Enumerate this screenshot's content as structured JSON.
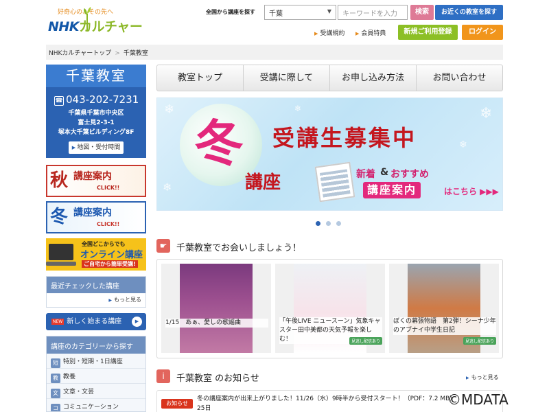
{
  "header": {
    "logo_tagline": "好奇心の、その先へ",
    "logo_nhk": "NHK",
    "logo_culture": "カルチャー",
    "search_label": "全国から講座を探す",
    "prefecture_selected": "千葉",
    "keyword_placeholder": "キーワードを入力",
    "search_button": "検索",
    "nearby_button": "お近くの教室を探す",
    "terms_link": "受講規約",
    "member_link": "会員特典",
    "register_button": "新規ご利用登録",
    "login_button": "ログイン"
  },
  "breadcrumb": [
    "NHKカルチャートップ",
    "千葉教室"
  ],
  "school": {
    "name": "千葉教室",
    "tel": "043-202-7231",
    "address": [
      "千葉県千葉市中央区",
      "富士見2-3-1",
      "塚本大千葉ビルディング8F"
    ],
    "map_button": "地図・受付時間"
  },
  "banners": {
    "autumn": {
      "kanji": "秋",
      "label": "講座案内",
      "click": "CLICK!!"
    },
    "winter": {
      "kanji": "冬",
      "label": "講座案内",
      "click": "CLICK!!"
    },
    "online": {
      "line1": "全国どこからでも",
      "line2": "オンライン講座",
      "line3": "ご自宅から簡単受講!"
    }
  },
  "sidebar": {
    "recent_title": "最近チェックした講座",
    "recent_more": "もっと見る",
    "new_badge": "NEW",
    "new_courses": "新しく始まる講座",
    "category_title": "講座のカテゴリーから探す",
    "categories": [
      {
        "icon": "短",
        "label": "特別・短期・1日講座"
      },
      {
        "icon": "教",
        "label": "教養"
      },
      {
        "icon": "文",
        "label": "文章・文芸"
      },
      {
        "icon": "コ",
        "label": "コミュニケーション"
      }
    ]
  },
  "tabs": [
    "教室トップ",
    "受講に際して",
    "お申し込み方法",
    "お問い合わせ"
  ],
  "hero": {
    "fuyu": "冬",
    "koza": "講座",
    "title": "受講生募集中",
    "new": "新着",
    "amp": "&",
    "recommend": "おすすめ",
    "pill": "講座案内",
    "here": "はこちら ▶▶▶"
  },
  "carousel": {
    "count": 3,
    "active": 0
  },
  "section_meet": {
    "title": "千葉教室でお会いしましょう！"
  },
  "cards": [
    {
      "text": "1/15　あぁ、愛しの歌謡曲",
      "badge": ""
    },
    {
      "text": "「午後LIVE ニュースーン」気象キャスター田中美都の天気予報を楽しむ！",
      "badge": "見逃し配信あり"
    },
    {
      "text": "ぼくの幕張物語　第2弾！シーナ少年のアブナイ中学生日記",
      "badge": "見逃し配信あり"
    }
  ],
  "notices": {
    "title": "千葉教室 のお知らせ",
    "more": "もっと見る",
    "items": [
      {
        "tag": "お知らせ",
        "text": "冬の講座案内が出来上がりました！11/26（水）9時半から受付スタート！（PDF：7.2 MB） 25日"
      }
    ]
  },
  "watermark": "©MDATA",
  "colors": {
    "brand_blue": "#2b62b2",
    "accent_pink": "#e3287c",
    "accent_red": "#c4171f",
    "green": "#8cbf25",
    "orange": "#f1951b"
  }
}
